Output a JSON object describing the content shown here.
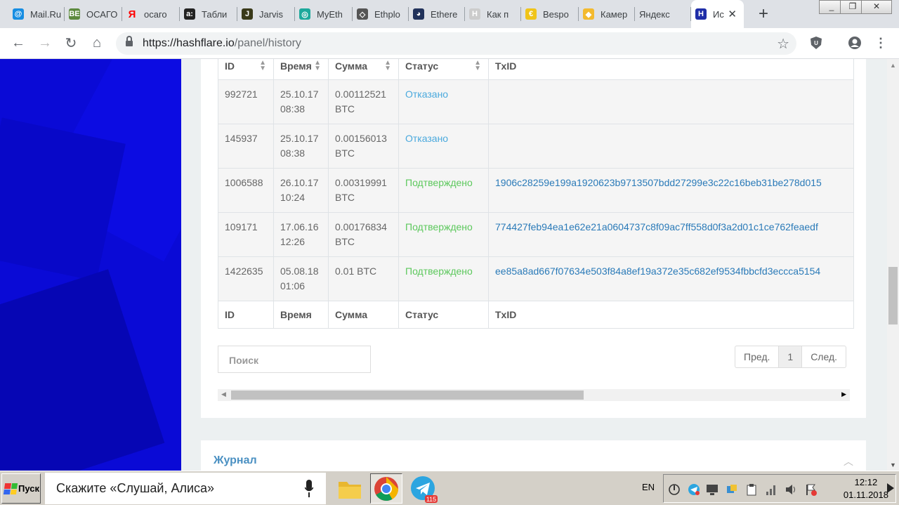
{
  "browser": {
    "tabs": [
      {
        "title": "Mail.Ru",
        "icon": "mail-ru-icon",
        "color": "#168de2",
        "glyph": "@"
      },
      {
        "title": "ОСАГО",
        "icon": "vk-icon",
        "color": "#5c8a3e",
        "glyph": "ВЕ"
      },
      {
        "title": "осаго",
        "icon": "yandex-icon",
        "color": "#ff0000",
        "glyph": "Я"
      },
      {
        "title": "Табли",
        "icon": "table-icon",
        "color": "#222222",
        "glyph": "a:"
      },
      {
        "title": "Jarvis",
        "icon": "jarvis-icon",
        "color": "#3a3a1a",
        "glyph": "J"
      },
      {
        "title": "MyEth",
        "icon": "myetherwallet-icon",
        "color": "#1da99c",
        "glyph": "◎"
      },
      {
        "title": "Ethplo",
        "icon": "ethplorer-icon",
        "color": "#555555",
        "glyph": "◇"
      },
      {
        "title": "Ethere",
        "icon": "etherscan-icon",
        "color": "#21325b",
        "glyph": "◕"
      },
      {
        "title": "Как п",
        "icon": "hashflare-gray-icon",
        "color": "#cccccc",
        "glyph": "H"
      },
      {
        "title": "Bespo",
        "icon": "bespoke-icon",
        "color": "#f0c419",
        "glyph": "€"
      },
      {
        "title": "Камер",
        "icon": "binance-icon",
        "color": "#f3ba2f",
        "glyph": "◆"
      },
      {
        "title": "Яндекс",
        "icon": "none",
        "color": "#dee1e6",
        "glyph": ""
      },
      {
        "title": "Ис",
        "icon": "hashflare-icon",
        "color": "#1f2ea8",
        "glyph": "H"
      }
    ],
    "new_tab_label": "+",
    "url_host": "https://hashflare.io",
    "url_path": "/panel/history",
    "window_buttons": [
      "_",
      "❐",
      "✕"
    ]
  },
  "table": {
    "headers": [
      "ID",
      "Время",
      "Сумма",
      "Статус",
      "TxID"
    ],
    "rows": [
      {
        "id": "992721",
        "date": "25.10.17",
        "time": "08:38",
        "amount": "0.00112521",
        "cur": "BTC",
        "status": "Отказано",
        "status_type": "refused",
        "txid": ""
      },
      {
        "id": "145937",
        "date": "25.10.17",
        "time": "08:38",
        "amount": "0.00156013",
        "cur": "BTC",
        "status": "Отказано",
        "status_type": "refused",
        "txid": ""
      },
      {
        "id": "1006588",
        "date": "26.10.17",
        "time": "10:24",
        "amount": "0.00319991",
        "cur": "BTC",
        "status": "Подтверждено",
        "status_type": "confirmed",
        "txid": "1906c28259e199a1920623b9713507bdd27299e3c22c16beb31be278d015"
      },
      {
        "id": "109171",
        "date": "17.06.16",
        "time": "12:26",
        "amount": "0.00176834",
        "cur": "BTC",
        "status": "Подтверждено",
        "status_type": "confirmed",
        "txid": "774427feb94ea1e62e21a0604737c8f09ac7ff558d0f3a2d01c1ce762feaedf"
      },
      {
        "id": "1422635",
        "date": "05.08.18",
        "time": "01:06",
        "amount": "0.01 BTC",
        "cur": "",
        "status": "Подтверждено",
        "status_type": "confirmed",
        "txid": "ee85a8ad667f07634e503f84a8ef19a372e35c682ef9534fbbcfd3eccca5154"
      }
    ]
  },
  "search": {
    "placeholder": "Поиск"
  },
  "pagination": {
    "prev": "Пред.",
    "current": "1",
    "next": "След."
  },
  "journal": {
    "title": "Журнал"
  },
  "taskbar": {
    "start_label": "Пуск",
    "alice_prompt": "Скажите «Слушай, Алиса»",
    "telegram_badge": "115",
    "lang": "EN",
    "time": "12:12",
    "date": "01.11.2018"
  }
}
